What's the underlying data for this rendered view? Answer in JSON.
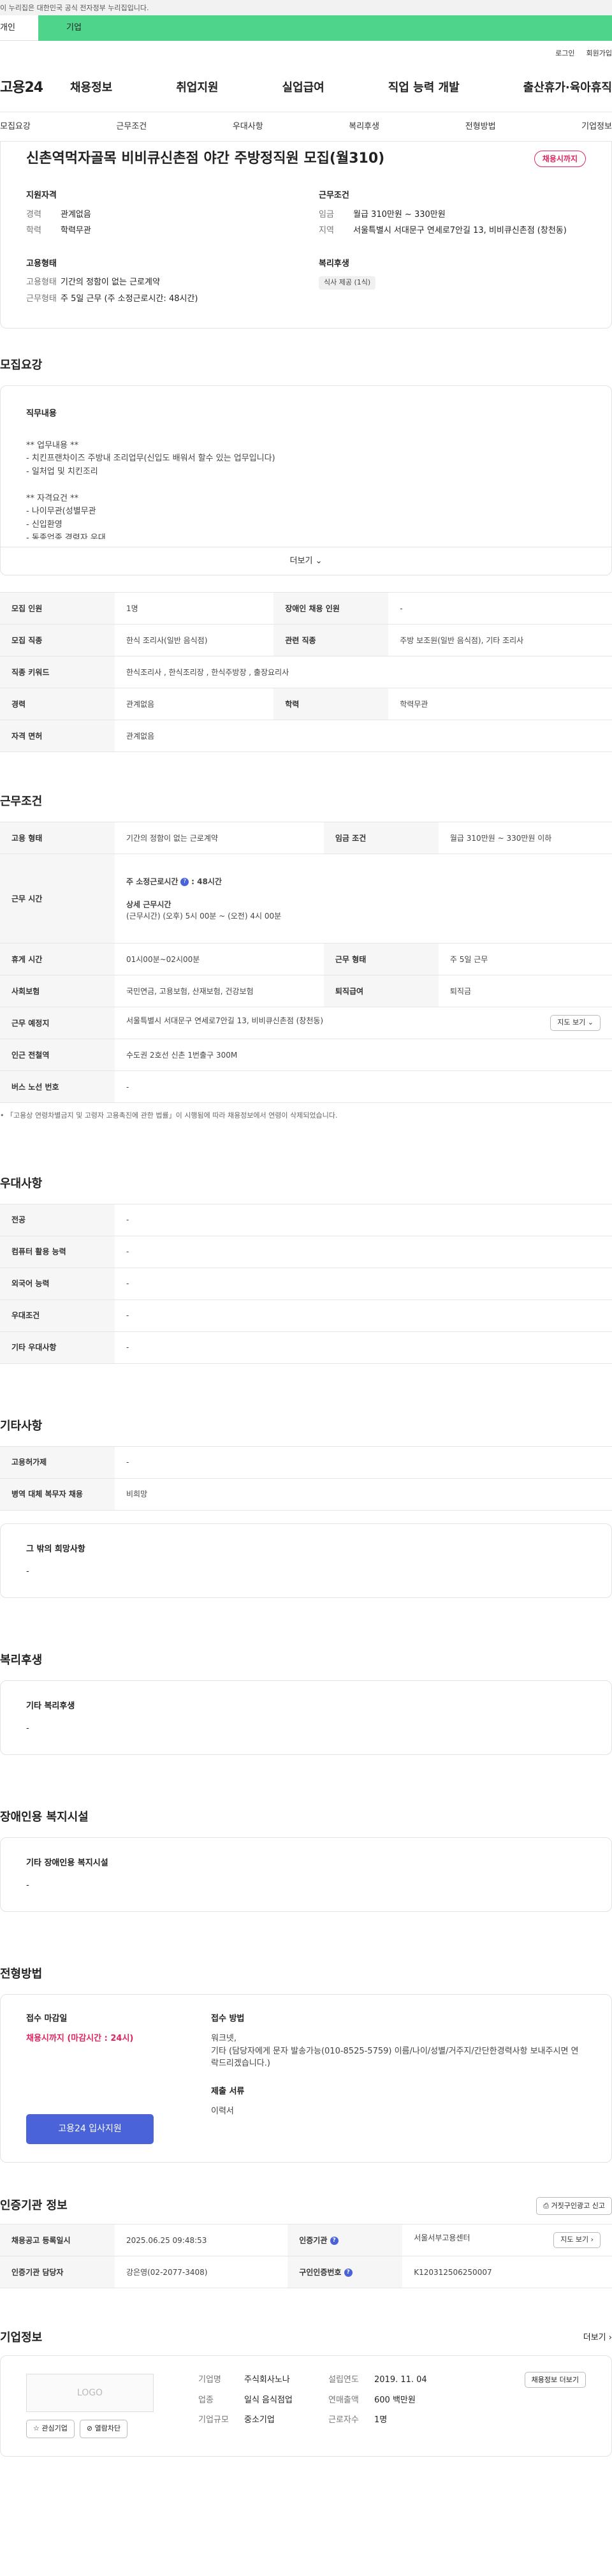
{
  "gov_banner": "이 누리집은 대한민국 공식 전자정부 누리집입니다.",
  "tabs": {
    "person": "개인",
    "company": "기업"
  },
  "utility": {
    "login": "로그인",
    "join": "회원가입"
  },
  "brand": "고용24",
  "gnb": [
    "채용정보",
    "취업지원",
    "실업급여",
    "직업 능력 개발",
    "출산휴가·육아휴직"
  ],
  "subnav": [
    "모집요강",
    "근무조건",
    "우대사항",
    "복리후생",
    "전형방법",
    "기업정보"
  ],
  "job": {
    "title": "신촌역먹자골목 비비큐신촌점 야간 주방정직원 모집(월310)",
    "status": "채용시까지",
    "qualification_title": "지원자격",
    "qualification": [
      {
        "k": "경력",
        "v": "관계없음"
      },
      {
        "k": "학력",
        "v": "학력무관"
      }
    ],
    "conditions_title": "근무조건",
    "conditions": [
      {
        "k": "임금",
        "v": "월급 310만원 ~ 330만원"
      },
      {
        "k": "지역",
        "v": "서울특별시 서대문구 연세로7안길 13, 비비큐신촌점 (창천동)"
      }
    ],
    "employment_title": "고용형태",
    "employment": [
      {
        "k": "고용형태",
        "v": "기간의 정함이 없는 근로계약"
      },
      {
        "k": "근무형태",
        "v": "주 5일 근무 (주 소정근로시간: 48시간)"
      }
    ],
    "welfare_title": "복리후생",
    "welfare_chip": "식사 제공 (1식)"
  },
  "recruit": {
    "section": "모집요강",
    "duty_title": "직무내용",
    "duty_text": "** 업무내용 **\n- 치킨프랜차이즈 주방내 조리업무(신입도 배워서 할수 있는 업무입니다)\n- 일처업 및 치킨조리\n\n** 자격요건 **\n- 나이무관(성별무관\n- 신입환영\n- 동종업종 경력자 우대\n- 인근거주자 우대",
    "more": "더보기",
    "rows": [
      {
        "k1": "모집 인원",
        "v1": "1명",
        "k2": "장애인 채용 인원",
        "v2": "-"
      },
      {
        "k1": "모집 직종",
        "v1": "한식 조리사(일반 음식점)",
        "k2": "관련 직종",
        "v2": "주방 보조원(일반 음식점), 기타 조리사"
      },
      {
        "k1": "직종 키워드",
        "v1": "한식조리사 , 한식조리장 , 한식주방장 , 출장요리사"
      },
      {
        "k1": "경력",
        "v1": "관계없음",
        "k2": "학력",
        "v2": "학력무관"
      },
      {
        "k1": "자격 면허",
        "v1": "관계없음"
      }
    ]
  },
  "work": {
    "section": "근무조건",
    "type_k": "고용 형태",
    "type_v": "기간의 정함이 없는 근로계약",
    "wage_k": "임금 조건",
    "wage_v": "월급 310만원 ~ 330만원 이하",
    "hours_k": "근무 시간",
    "hours_week": "주 소정근로시간",
    "hours_week_val": ": 48시간",
    "hours_detail_title": "상세 근무시간",
    "hours_detail": "(근무시간) (오후) 5시 00분 ~ (오전) 4시 00분",
    "break_k": "휴게 시간",
    "break_v": "01시00분~02시00분",
    "form_k": "근무 형태",
    "form_v": "주 5일 근무",
    "ins_k": "사회보험",
    "ins_v": "국민연금, 고용보험, 산재보험, 건강보험",
    "sev_k": "퇴직급여",
    "sev_v": "퇴직금",
    "place_k": "근무 예정지",
    "place_v": "서울특별시 서대문구 연세로7안길 13, 비비큐신촌점 (창천동)",
    "map_btn": "지도 보기",
    "subway_k": "인근 전철역",
    "subway_v": "수도권 2호선 신촌 1번출구 300M",
    "bus_k": "버스 노선 번호",
    "bus_v": "-",
    "note": "「고용상 연령차별금지 및 고령자 고용촉진에 관한 법률」이 시행됨에 따라 채용정보에서 연령이 삭제되었습니다."
  },
  "preference": {
    "section": "우대사항",
    "rows": [
      {
        "k": "전공",
        "v": "-"
      },
      {
        "k": "컴퓨터 활용 능력",
        "v": "-"
      },
      {
        "k": "외국어 능력",
        "v": "-"
      },
      {
        "k": "우대조건",
        "v": "-"
      },
      {
        "k": "기타 우대사항",
        "v": "-"
      }
    ]
  },
  "others": {
    "section": "기타사항",
    "rows": [
      {
        "k": "고용허가제",
        "v": "-"
      },
      {
        "k": "병역 대체 복무자 채용",
        "v": "비희망"
      }
    ],
    "etc_title": "그 밖의 희망사항",
    "etc_value": "-"
  },
  "welfare": {
    "section": "복리후생",
    "title": "기타 복리후생",
    "value": "-"
  },
  "disability": {
    "section": "장애인용 복지시설",
    "title": "기타 장애인용 복지시설",
    "value": "-"
  },
  "selection": {
    "section": "전형방법",
    "deadline_title": "접수 마감일",
    "deadline": "채용시까지 (마감시간 : 24시)",
    "apply_btn": "고용24 입사지원",
    "method_title": "접수 방법",
    "method_text": "워크넷,\n기타 (담당자에게 문자 발송가능(010-8525-5759) 이름/나이/성별/거주지/간단한경력사항 보내주시면 연락드리겠습니다.)",
    "docs_title": "제출 서류",
    "docs": "이력서"
  },
  "institution": {
    "section": "인증기관 정보",
    "report_btn": "거짓구인광고 신고",
    "reg_k": "채용공고 등록일시",
    "reg_v": "2025.06.25 09:48:53",
    "org_k": "인증기관",
    "org_v": "서울서부고용센터",
    "map_btn": "지도 보기",
    "mgr_k": "인증기관 담당자",
    "mgr_v": "강은영(02-2077-3408)",
    "num_k": "구인인증번호",
    "num_v": "K120312506250007"
  },
  "company": {
    "section": "기업정보",
    "more": "더보기",
    "logo": "LOGO",
    "fav_btn": "관심기업",
    "block_btn": "열람차단",
    "fields": [
      {
        "k": "기업명",
        "v": "주식회사노나",
        "k2": "설립연도",
        "v2": "2019. 11. 04"
      },
      {
        "k": "업종",
        "v": "일식 음식점업",
        "k2": "연매출액",
        "v2": "600 백만원"
      },
      {
        "k": "기업규모",
        "v": "중소기업",
        "k2": "근로자수",
        "v2": "1명"
      }
    ],
    "jobs_btn": "채용정보 더보기"
  }
}
